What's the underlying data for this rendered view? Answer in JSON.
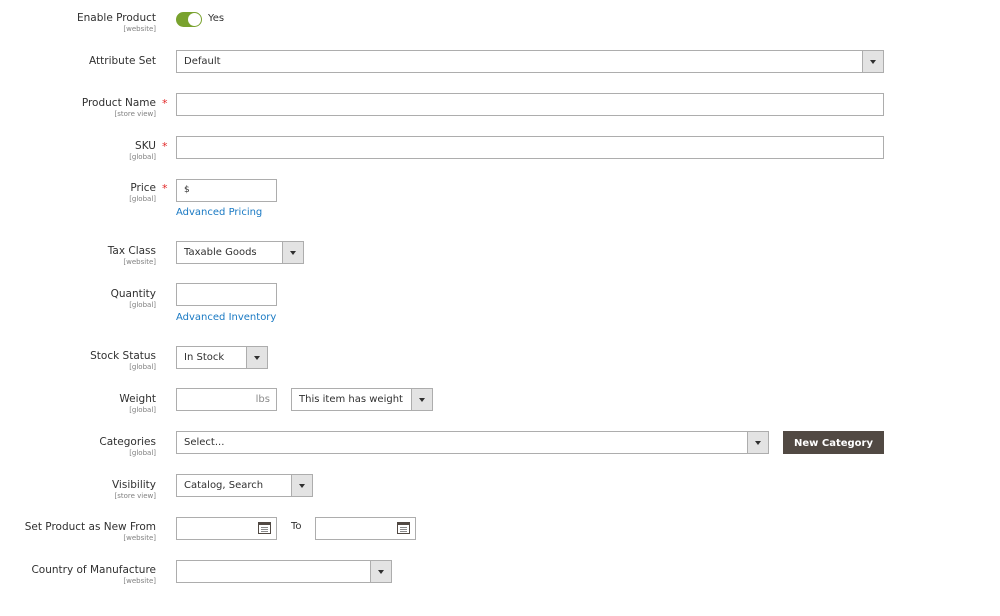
{
  "fields": {
    "enable_product": {
      "label": "Enable Product",
      "scope": "[website]",
      "value": "Yes",
      "enabled": true
    },
    "attribute_set": {
      "label": "Attribute Set",
      "value": "Default"
    },
    "product_name": {
      "label": "Product Name",
      "scope": "[store view]",
      "required_mark": "*",
      "value": ""
    },
    "sku": {
      "label": "SKU",
      "scope": "[global]",
      "required_mark": "*",
      "value": ""
    },
    "price": {
      "label": "Price",
      "scope": "[global]",
      "required_mark": "*",
      "prefix": "$",
      "value": "",
      "link": "Advanced Pricing"
    },
    "tax_class": {
      "label": "Tax Class",
      "scope": "[website]",
      "value": "Taxable Goods"
    },
    "quantity": {
      "label": "Quantity",
      "scope": "[global]",
      "value": "",
      "link": "Advanced Inventory"
    },
    "stock_status": {
      "label": "Stock Status",
      "scope": "[global]",
      "value": "In Stock"
    },
    "weight": {
      "label": "Weight",
      "scope": "[global]",
      "unit": "lbs",
      "value": "",
      "type_value": "This item has weight"
    },
    "categories": {
      "label": "Categories",
      "scope": "[global]",
      "placeholder": "Select...",
      "button": "New Category"
    },
    "visibility": {
      "label": "Visibility",
      "scope": "[store view]",
      "value": "Catalog, Search"
    },
    "new_from": {
      "label": "Set Product as New From",
      "scope": "[website]",
      "to_label": "To",
      "from_value": "",
      "to_value": ""
    },
    "country": {
      "label": "Country of Manufacture",
      "scope": "[website]",
      "value": ""
    }
  },
  "colors": {
    "toggle_on": "#79a22e",
    "link": "#1979c3",
    "required": "#e22626",
    "primary_button": "#514943"
  }
}
